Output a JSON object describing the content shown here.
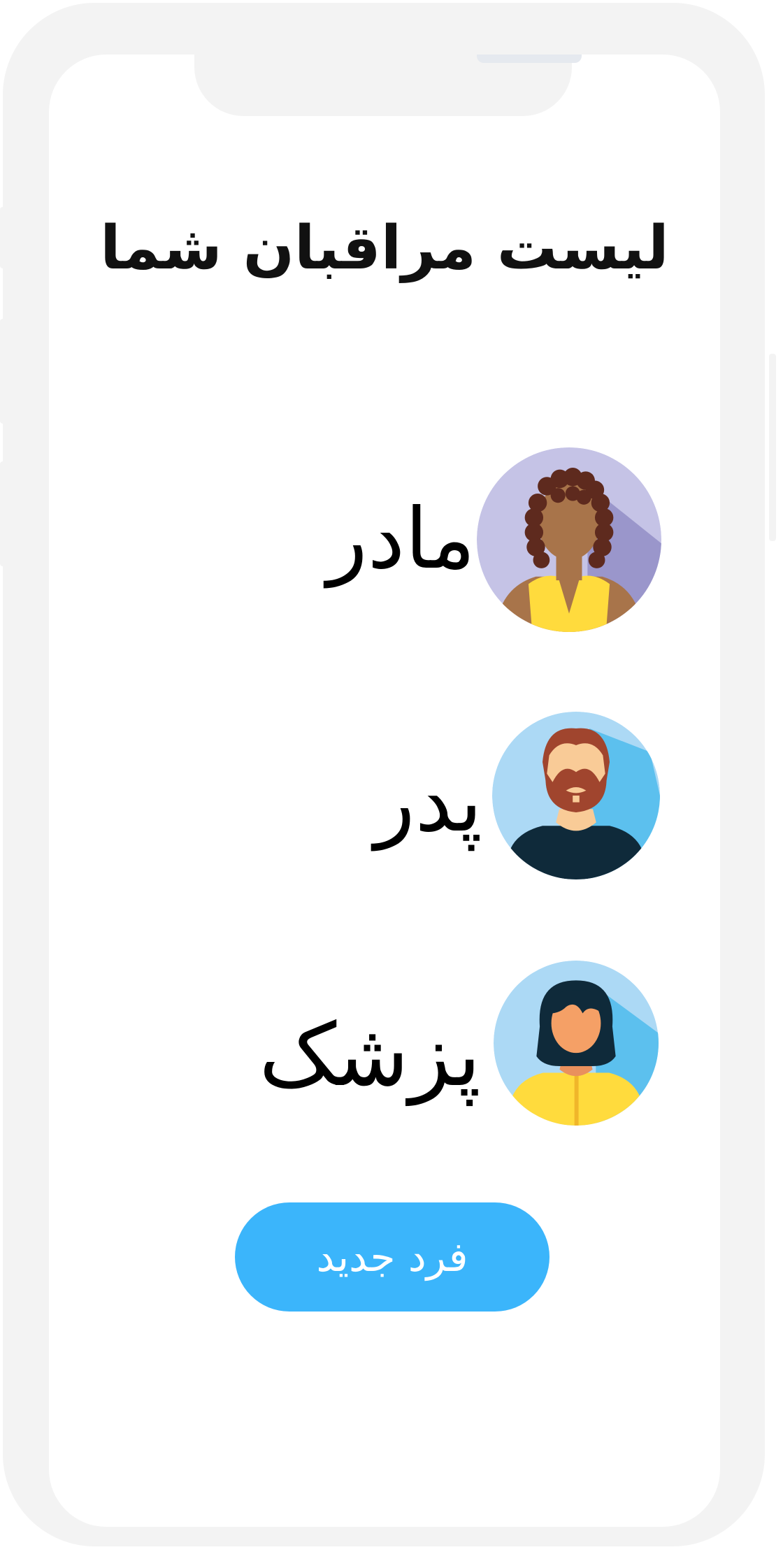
{
  "title": "لیست مراقبان شما",
  "caregivers": [
    {
      "name": "مادر",
      "avatar": "woman-curly-hair-avatar"
    },
    {
      "name": "پدر",
      "avatar": "bearded-man-avatar"
    },
    {
      "name": "پزشک",
      "avatar": "woman-dark-hair-avatar"
    }
  ],
  "new_button": {
    "label": "فرد جدید"
  },
  "colors": {
    "frame": "#f3f3f3",
    "button": "#3bb5fb",
    "avatar_lavender": "#c5c3e6",
    "avatar_sky": "#acd9f5"
  }
}
